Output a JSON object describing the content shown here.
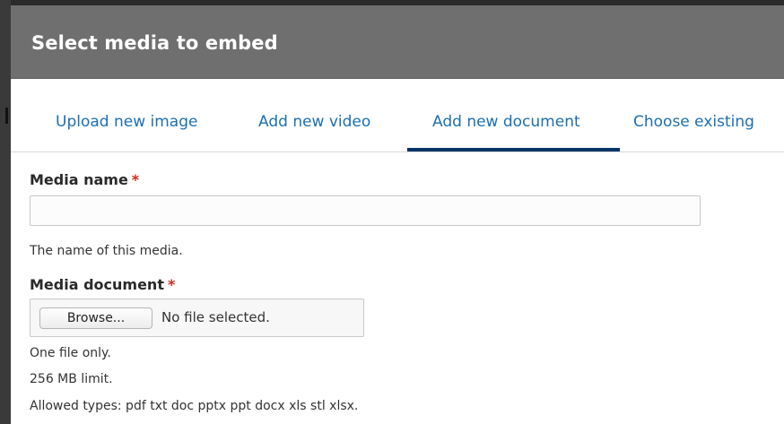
{
  "dialog": {
    "title": "Select media to embed"
  },
  "tabs": [
    {
      "label": "Upload new image",
      "active": false
    },
    {
      "label": "Add new video",
      "active": false
    },
    {
      "label": "Add new document",
      "active": true
    },
    {
      "label": "Choose existing",
      "active": false
    }
  ],
  "form": {
    "media_name": {
      "label": "Media name",
      "required_marker": "*",
      "value": "",
      "description": "The name of this media."
    },
    "media_document": {
      "label": "Media document",
      "required_marker": "*",
      "browse_label": "Browse...",
      "file_status": "No file selected.",
      "help": [
        "One file only.",
        "256 MB limit.",
        "Allowed types: pdf txt doc pptx ppt docx xls stl xlsx."
      ]
    }
  },
  "colors": {
    "titlebar": "#6f6f6f",
    "tab_link": "#1d6fb3",
    "active_tab_underline": "#003366",
    "required": "#d4281c"
  }
}
